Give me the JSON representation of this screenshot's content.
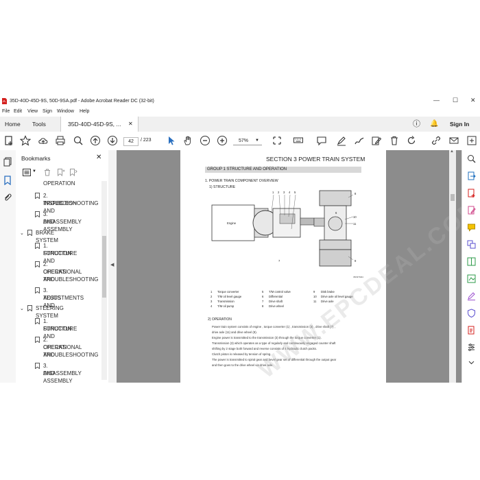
{
  "window": {
    "title": "35D-40D-45D-9S, 50D-9SA.pdf - Adobe Acrobat Reader DC (32-bit)"
  },
  "menu": [
    "File",
    "Edit",
    "View",
    "Sign",
    "Window",
    "Help"
  ],
  "tabs": {
    "home": "Home",
    "tools": "Tools",
    "document": "35D-40D-45D-9S, ...",
    "sign_in": "Sign In"
  },
  "toolbar": {
    "page_current": "42",
    "page_total": "/ 223",
    "zoom": "57%"
  },
  "bookmarks": {
    "header": "Bookmarks",
    "items": [
      {
        "label": "OPERATION",
        "level": 2
      },
      {
        "label": "2. INSPECTION AND TROUBLESHOOTING",
        "l1": "2. INSPECTION AND",
        "l2": "TROUBLESHOOTING",
        "level": 2
      },
      {
        "label": "3. DISASSEMBLY AND ASSEMBLY",
        "l1": "3. DISASSEMBLY",
        "l2": "AND ASSEMBLY",
        "level": 2
      },
      {
        "label": "BRAKE SYSTEM",
        "level": 1
      },
      {
        "label": "1. STRUCTURE AND FUNCTION",
        "l1": "1. STRUCTURE AND",
        "l2": "FUNCTION",
        "level": 2
      },
      {
        "label": "2. OPERATIONAL CHECKS AND TROUBLESHOOTING",
        "l1": "2. OPERATIONAL",
        "l2": "CHECKS AND",
        "l3": "TROUBLESHOOTING",
        "level": 2
      },
      {
        "label": "3. TESTS AND ADJUSTMENTS",
        "l1": "3. TESTS AND",
        "l2": "ADJUSTMENTS",
        "level": 2
      },
      {
        "label": "STEERING SYSTEM",
        "level": 1
      },
      {
        "label": "1. STRUCTURE AND FUNCTION",
        "l1": "1. STRUCTURE AND",
        "l2": "FUNCTION",
        "level": 2
      },
      {
        "label": "2. OPERATIONAL CHECKS AND TROUBLESHOOTING",
        "l1": "2. OPERATIONAL",
        "l2": "CHECKS AND",
        "l3": "TROUBLESHOOTING",
        "level": 2
      },
      {
        "label": "3. DISASSEMBLY AND ASSEMBLY",
        "l1": "3. DISASSEMBLY",
        "l2": "AND ASSEMBLY",
        "level": 2
      }
    ]
  },
  "document": {
    "section_title": "SECTION  3  POWER TRAIN SYSTEM",
    "group": "GROUP  1  STRUCTURE AND OPERATION",
    "sub1": "1. POWER TRAIN COMPONENT OVERVIEW",
    "sub2": "1) STRUCTURE",
    "engine_label": "Engine",
    "figure_code": "35D9TM04",
    "callouts": [
      "1",
      "2",
      "3",
      "4",
      "5",
      "6",
      "7",
      "8",
      "9",
      "10",
      "11"
    ],
    "legend": [
      [
        "1",
        "Torque converter"
      ],
      [
        "2",
        "T/M oil level gauge"
      ],
      [
        "3",
        "Transmission"
      ],
      [
        "4",
        "T/M oil pump"
      ],
      [
        "5",
        "T/M control valve"
      ],
      [
        "6",
        "Differential"
      ],
      [
        "7",
        "Drive shaft"
      ],
      [
        "8",
        "Drive wheel"
      ],
      [
        "9",
        "Disk brake"
      ],
      [
        "10",
        "Drive axle oil level gauge"
      ],
      [
        "11",
        "Drive axle"
      ]
    ],
    "operation_heading": "2) OPERATION",
    "paragraph": [
      "Power train system consists of engine , torque converter (1) , transmission (3) , drive shaft (7) ,",
      "drive axle (11) and drive wheel (8).",
      "Engine power is transmitted to the transmission (3) through the torque converter (1).",
      "Transmission (3) which operates as a type of regularly and continuously engaged counter shaft",
      "shifting by 2 stage both forward and reverse consists of 4 hydraulic clutch packs.",
      "Clutch piston is released by tension of spring.",
      "The power is transmitted to spiral gear and bevel gear set of differential through the output gear",
      "and then goes to the drive wheel via drive axle."
    ],
    "watermark": "WWW.EPCDEAL.COM"
  },
  "colors": {
    "acrobat_red": "#d4201e",
    "doc_bg": "#8c8c8c",
    "group_bar": "#d8d8d8"
  }
}
